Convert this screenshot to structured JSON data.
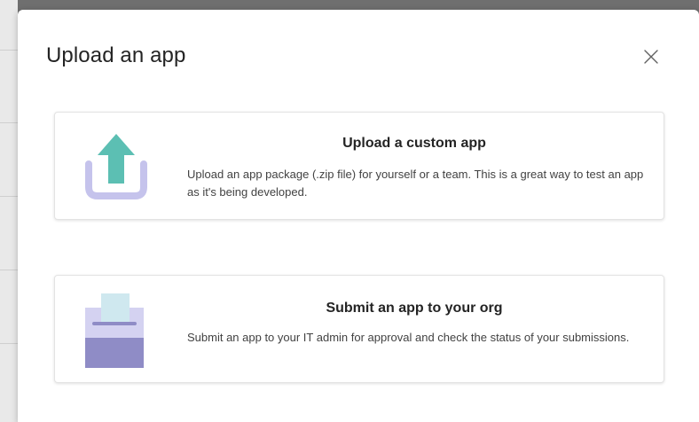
{
  "dialog": {
    "title": "Upload an app",
    "close_icon": "close-icon"
  },
  "options": [
    {
      "title": "Upload a custom app",
      "description": "Upload an app package (.zip file) for yourself or a team. This is a great way to test an app as it's being developed.",
      "icon": "upload-arrow-icon"
    },
    {
      "title": "Submit an app to your org",
      "description": "Submit an app to your IT admin for approval and check the status of your submissions.",
      "icon": "submit-box-icon"
    }
  ],
  "colors": {
    "icon_teal": "#5cbfb3",
    "icon_tray": "#c5c3ec",
    "icon_box_dark": "#8f8cc6",
    "icon_box_light": "#d4d2f1",
    "icon_paper": "#cfe8ef",
    "backdrop": "#6f6f6f"
  }
}
